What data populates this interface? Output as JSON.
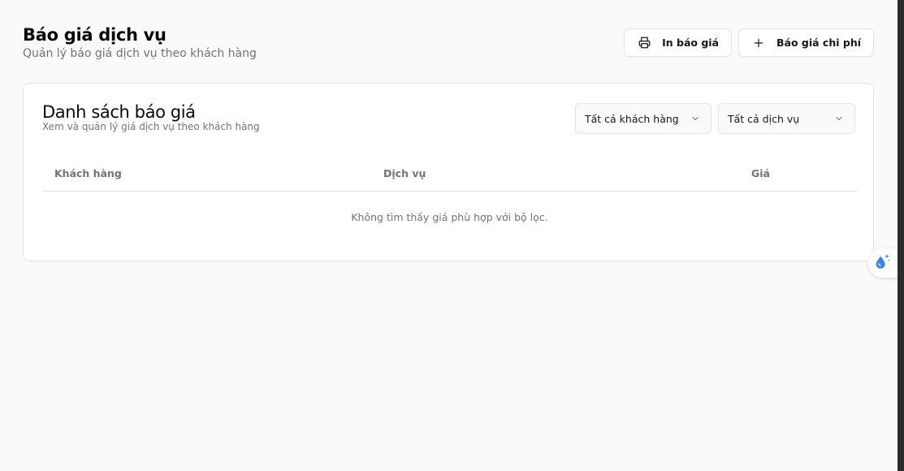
{
  "header": {
    "title": "Báo giá dịch vụ",
    "subtitle": "Quản lý báo giá dịch vụ theo khách hàng",
    "print_label": "In báo giá",
    "add_label": "Báo giá chi phí"
  },
  "card": {
    "title": "Danh sách báo giá",
    "subtitle": "Xem và quản lý giá dịch vụ theo khách hàng",
    "filters": {
      "customer": "Tất cả khách hàng",
      "service": "Tất cả dịch vụ"
    }
  },
  "table": {
    "columns": [
      "Khách hàng",
      "Dịch vụ",
      "Giá"
    ],
    "empty_message": "Không tìm thấy giá phù hợp với bộ lọc."
  },
  "icons": {
    "print": "printer-icon",
    "add": "plus-icon",
    "chevron": "chevron-down-icon",
    "assistant": "sparkle-droplet-icon"
  },
  "colors": {
    "accent": "#3b82f6",
    "muted_text": "#737373",
    "border": "#e5e5e5"
  }
}
